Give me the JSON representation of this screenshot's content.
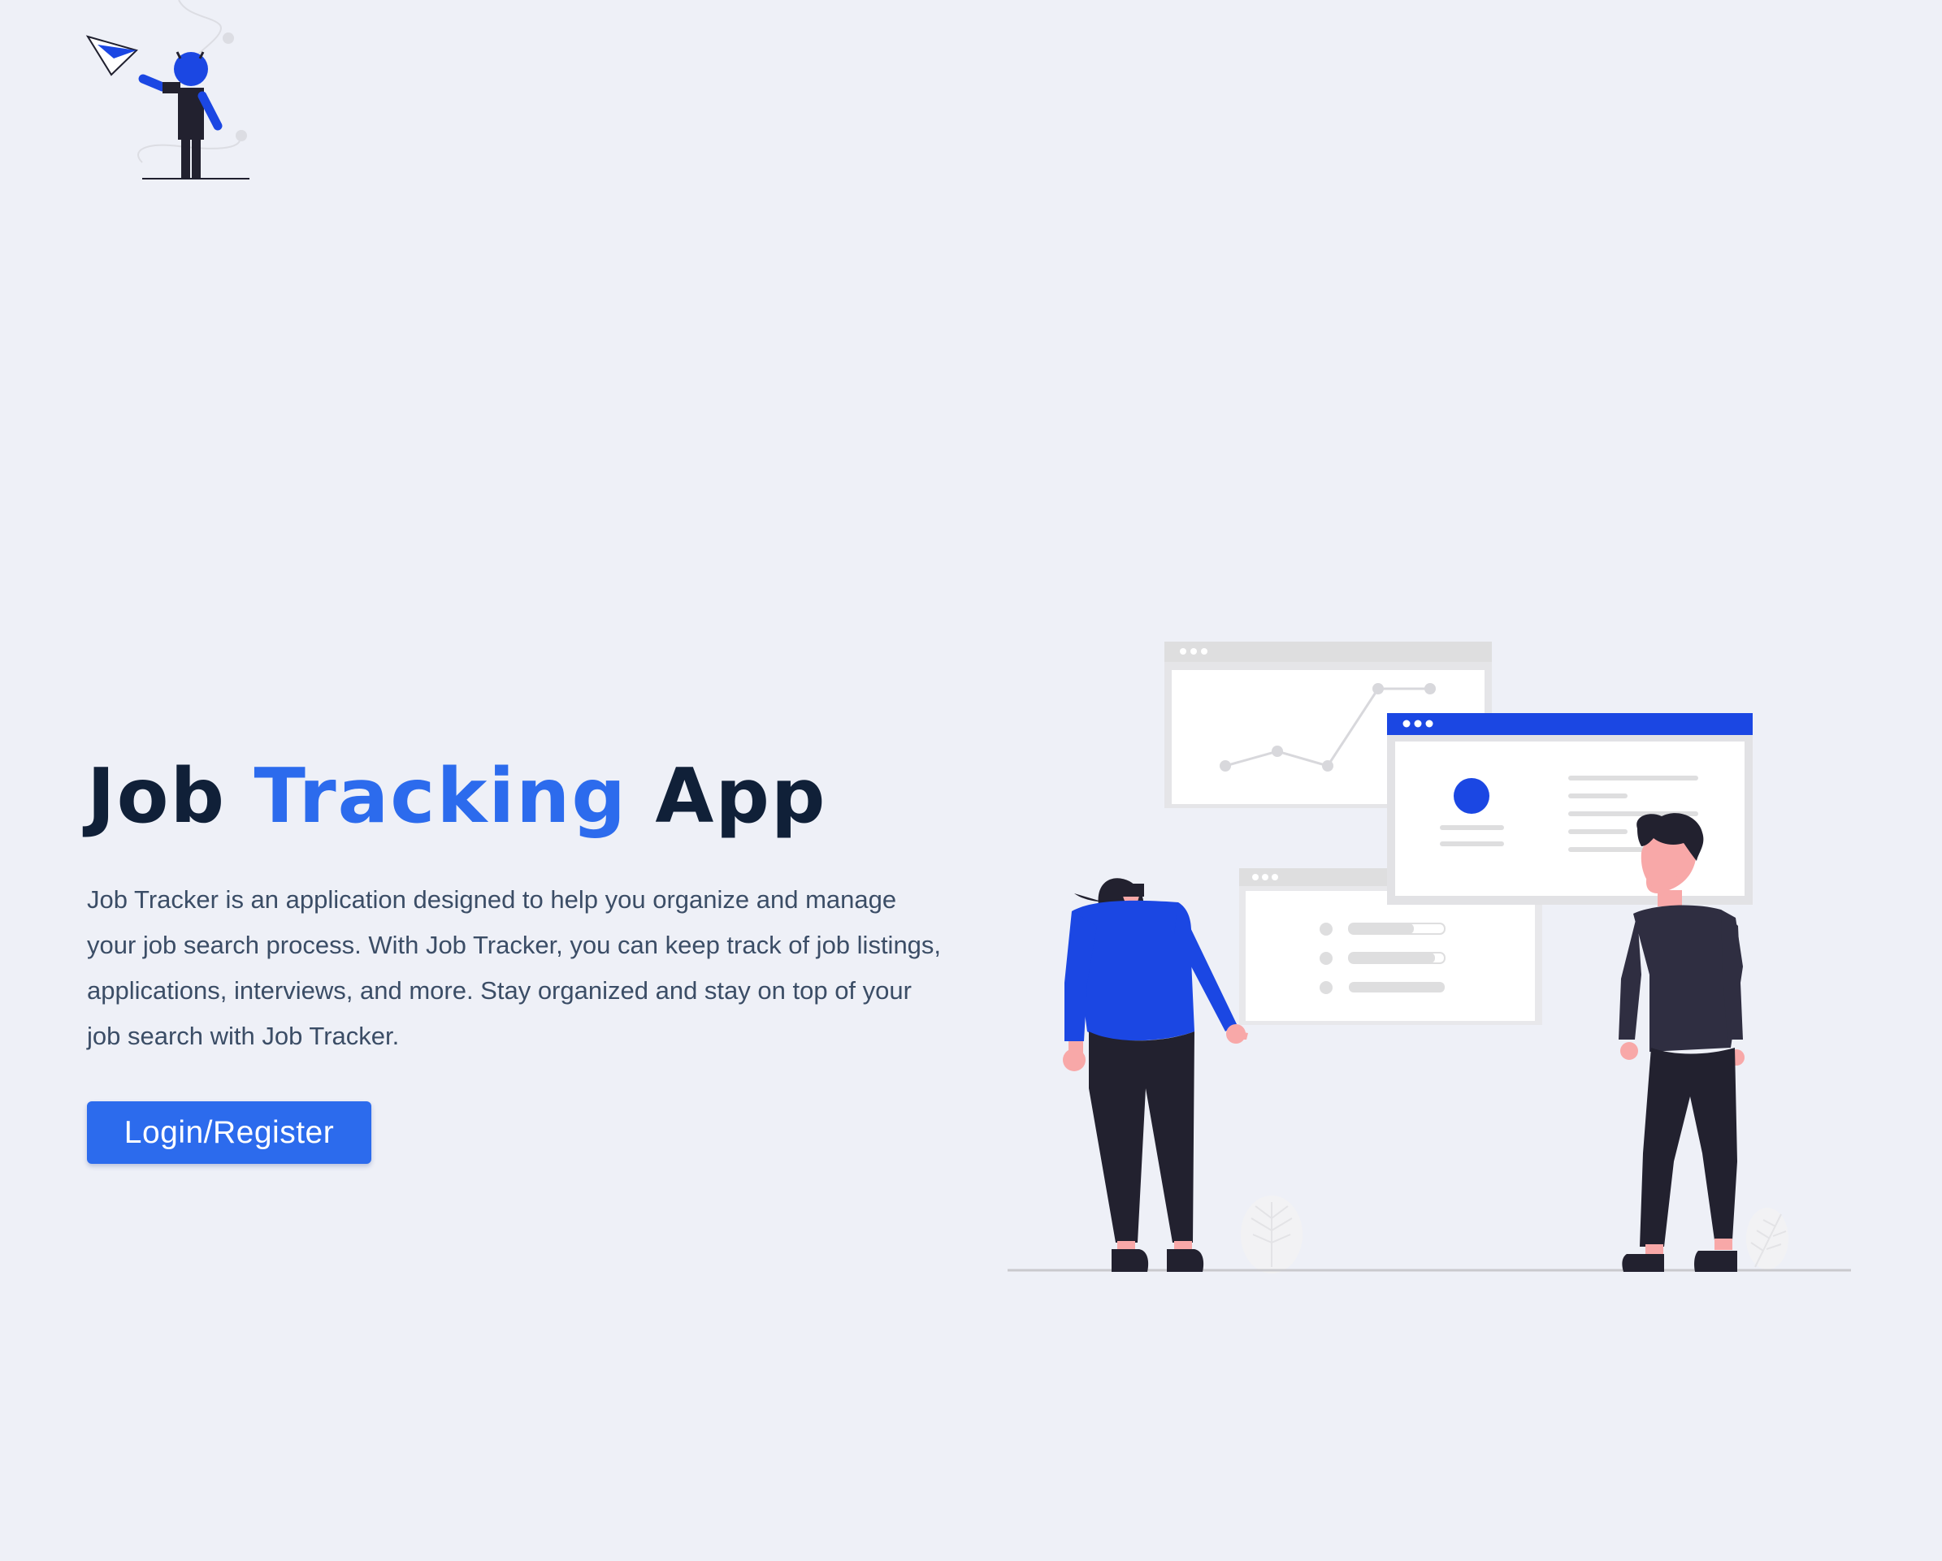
{
  "brand": {
    "logo_icon": "paper-plane-person-icon"
  },
  "hero": {
    "title_part1": "Job",
    "title_accent": "Tracking",
    "title_part2": "App",
    "description": "Job Tracker is an application designed to help you organize and manage your job search process. With Job Tracker, you can keep track of job listings, applications, interviews, and more. Stay organized and stay on top of your job search with Job Tracker.",
    "cta_label": "Login/Register"
  },
  "illustration": {
    "icon": "team-dashboard-illustration"
  },
  "colors": {
    "background": "#eef0f7",
    "accent": "#2c6bed",
    "title": "#102038",
    "text": "#3b4d66",
    "illustration_blue": "#1b47e3",
    "illustration_dark": "#22212f"
  }
}
